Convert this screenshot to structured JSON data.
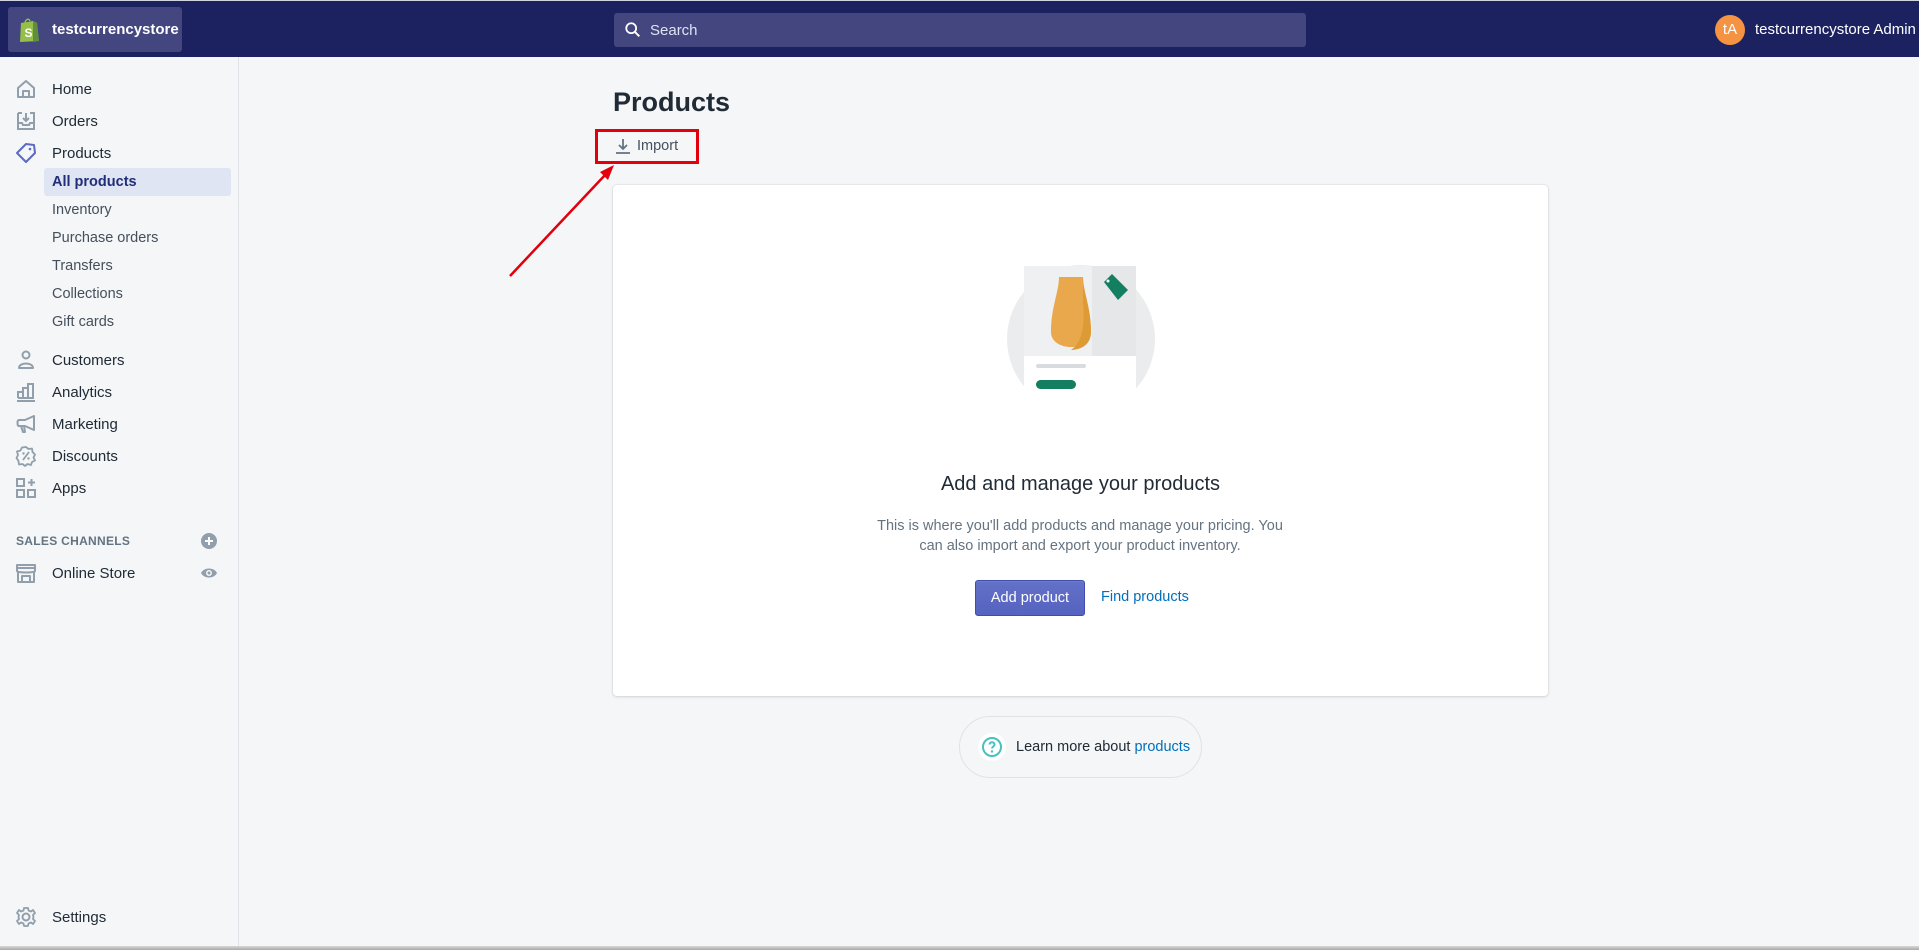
{
  "topbar": {
    "store_name": "testcurrencystore",
    "search_placeholder": "Search",
    "user": {
      "initials": "tA",
      "name": "testcurrencystore Admin"
    }
  },
  "sidebar": {
    "items": [
      {
        "label": "Home",
        "icon": "home-icon"
      },
      {
        "label": "Orders",
        "icon": "orders-icon"
      },
      {
        "label": "Products",
        "icon": "tag-icon",
        "active": true
      },
      {
        "label": "Customers",
        "icon": "customer-icon"
      },
      {
        "label": "Analytics",
        "icon": "analytics-icon"
      },
      {
        "label": "Marketing",
        "icon": "megaphone-icon"
      },
      {
        "label": "Discounts",
        "icon": "discount-icon"
      },
      {
        "label": "Apps",
        "icon": "apps-icon"
      }
    ],
    "product_subitems": [
      {
        "label": "All products",
        "active": true
      },
      {
        "label": "Inventory"
      },
      {
        "label": "Purchase orders"
      },
      {
        "label": "Transfers"
      },
      {
        "label": "Collections"
      },
      {
        "label": "Gift cards"
      }
    ],
    "sales_channels": {
      "title": "SALES CHANNELS",
      "items": [
        {
          "label": "Online Store",
          "icon": "store-icon"
        }
      ]
    },
    "settings_label": "Settings"
  },
  "main": {
    "page_title": "Products",
    "import_label": "Import",
    "empty_state": {
      "heading": "Add and manage your products",
      "text": "This is where you'll add products and manage your pricing. You can also import and export your product inventory.",
      "primary_action": "Add product",
      "secondary_action": "Find products"
    },
    "learn_more": {
      "prefix": "Learn more about",
      "link": "products"
    }
  },
  "annotation": {
    "color": "#e1000b",
    "target": "Import"
  },
  "colors": {
    "topbar": "#1c2260",
    "primary": "#5c6ac4",
    "link": "#006fbb",
    "avatar": "#f49342",
    "shopify_green": "#95bf47"
  }
}
